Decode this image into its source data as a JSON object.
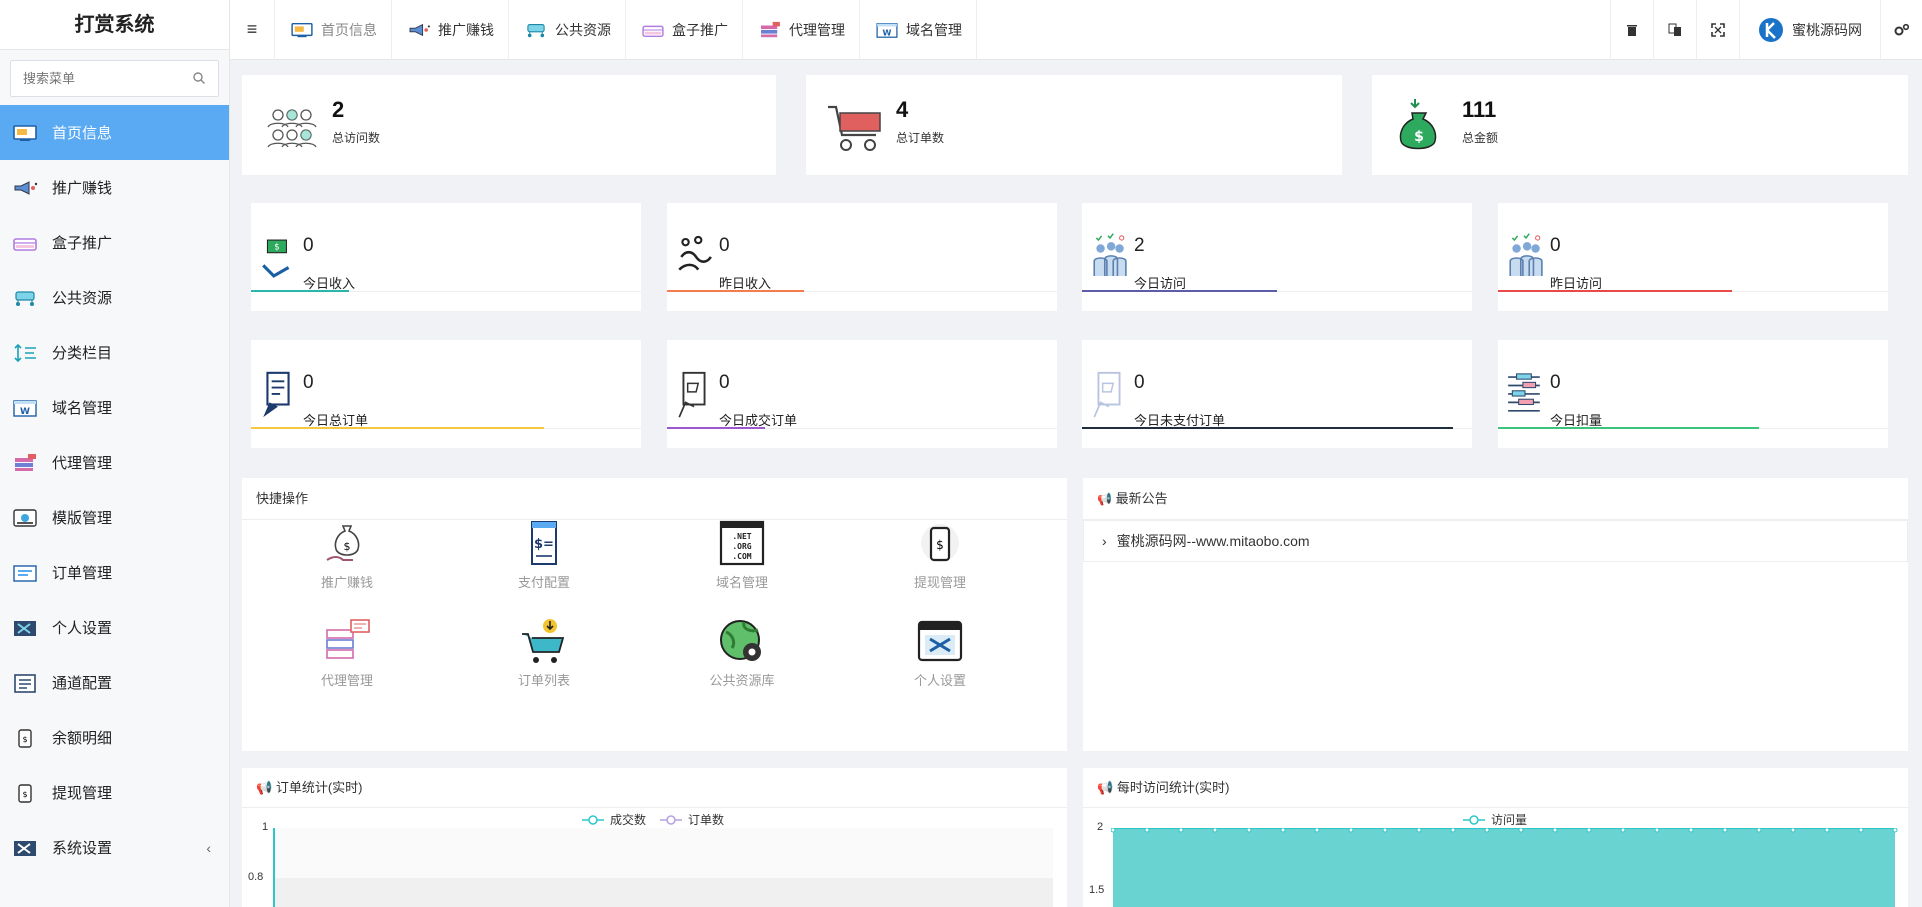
{
  "app": {
    "title": "打赏系统"
  },
  "sidebar": {
    "search_placeholder": "搜索菜单",
    "items": [
      {
        "label": "首页信息",
        "icon": "monitor-icon"
      },
      {
        "label": "推广赚钱",
        "icon": "promo-icon"
      },
      {
        "label": "盒子推广",
        "icon": "box-icon"
      },
      {
        "label": "公共资源",
        "icon": "network-icon"
      },
      {
        "label": "分类栏目",
        "icon": "sort-icon"
      },
      {
        "label": "域名管理",
        "icon": "domain-icon"
      },
      {
        "label": "代理管理",
        "icon": "agent-icon"
      },
      {
        "label": "模版管理",
        "icon": "template-icon"
      },
      {
        "label": "订单管理",
        "icon": "order-icon"
      },
      {
        "label": "个人设置",
        "icon": "tools-icon"
      },
      {
        "label": "通道配置",
        "icon": "channel-icon"
      },
      {
        "label": "余额明细",
        "icon": "balance-icon"
      },
      {
        "label": "提现管理",
        "icon": "withdraw-icon"
      },
      {
        "label": "系统设置",
        "icon": "settings-icon"
      }
    ],
    "collapse_arrow": "‹"
  },
  "header": {
    "tabs": [
      {
        "label": "首页信息",
        "icon": "monitor-icon"
      },
      {
        "label": "推广赚钱",
        "icon": "promo-icon"
      },
      {
        "label": "公共资源",
        "icon": "network-icon"
      },
      {
        "label": "盒子推广",
        "icon": "box-icon"
      },
      {
        "label": "代理管理",
        "icon": "agent-icon"
      },
      {
        "label": "域名管理",
        "icon": "domain-icon"
      }
    ],
    "user_name": "蜜桃源码网"
  },
  "summary": [
    {
      "value": "2",
      "label": "总访问数"
    },
    {
      "value": "4",
      "label": "总订单数"
    },
    {
      "value": "111",
      "label": "总金额"
    }
  ],
  "stats_row1": [
    {
      "value": "0",
      "label": "今日收入",
      "color": "#2ab7a9",
      "fill": 0.25
    },
    {
      "value": "0",
      "label": "昨日收入",
      "color": "#f47c4f",
      "fill": 0.35
    },
    {
      "value": "2",
      "label": "今日访问",
      "color": "#5b5ea6",
      "fill": 0.5
    },
    {
      "value": "0",
      "label": "昨日访问",
      "color": "#e84a4a",
      "fill": 0.6
    }
  ],
  "stats_row2": [
    {
      "value": "0",
      "label": "今日总订单",
      "color": "#f6c93c",
      "fill": 0.75
    },
    {
      "value": "0",
      "label": "今日成交订单",
      "color": "#9b59d0",
      "fill": 0.25
    },
    {
      "value": "0",
      "label": "今日未支付订单",
      "color": "#1f2d3d",
      "fill": 0.95
    },
    {
      "value": "0",
      "label": "今日扣量",
      "color": "#3cc47c",
      "fill": 0.67
    }
  ],
  "quick_actions": {
    "title": "快捷操作",
    "items": [
      {
        "label": "推广赚钱",
        "icon": "money-bag-icon"
      },
      {
        "label": "支付配置",
        "icon": "receipt-icon"
      },
      {
        "label": "域名管理",
        "icon": "domain-ext-icon",
        "icon_text": [
          ".NET",
          ".ORG",
          ".COM"
        ]
      },
      {
        "label": "提现管理",
        "icon": "phone-dollar-icon"
      },
      {
        "label": "代理管理",
        "icon": "server-icon"
      },
      {
        "label": "订单列表",
        "icon": "cart-icon"
      },
      {
        "label": "公共资源库",
        "icon": "globe-gear-icon"
      },
      {
        "label": "个人设置",
        "icon": "window-tools-icon"
      }
    ]
  },
  "notice": {
    "title": "最新公告",
    "items": [
      "蜜桃源码网--www.mitaobo.com"
    ]
  },
  "charts": {
    "order_title": "订单统计(实时)",
    "visit_title": "每时访问统计(实时)"
  },
  "chart_data": [
    {
      "type": "line",
      "title": "订单统计(实时)",
      "series": [
        {
          "name": "成交数",
          "color": "#2ec7c9"
        },
        {
          "name": "订单数",
          "color": "#b6a2de"
        }
      ],
      "y_ticks": [
        "1",
        "0.8"
      ]
    },
    {
      "type": "area",
      "title": "每时访问统计(实时)",
      "series": [
        {
          "name": "访问量",
          "color": "#2ec7c9",
          "values": [
            2,
            2,
            2,
            2,
            2,
            2,
            2,
            2,
            2,
            2,
            2,
            2,
            2,
            2,
            2,
            2,
            2,
            2,
            2,
            2,
            2,
            2,
            2,
            2
          ]
        }
      ],
      "y_ticks": [
        "2",
        "1.5"
      ]
    }
  ]
}
